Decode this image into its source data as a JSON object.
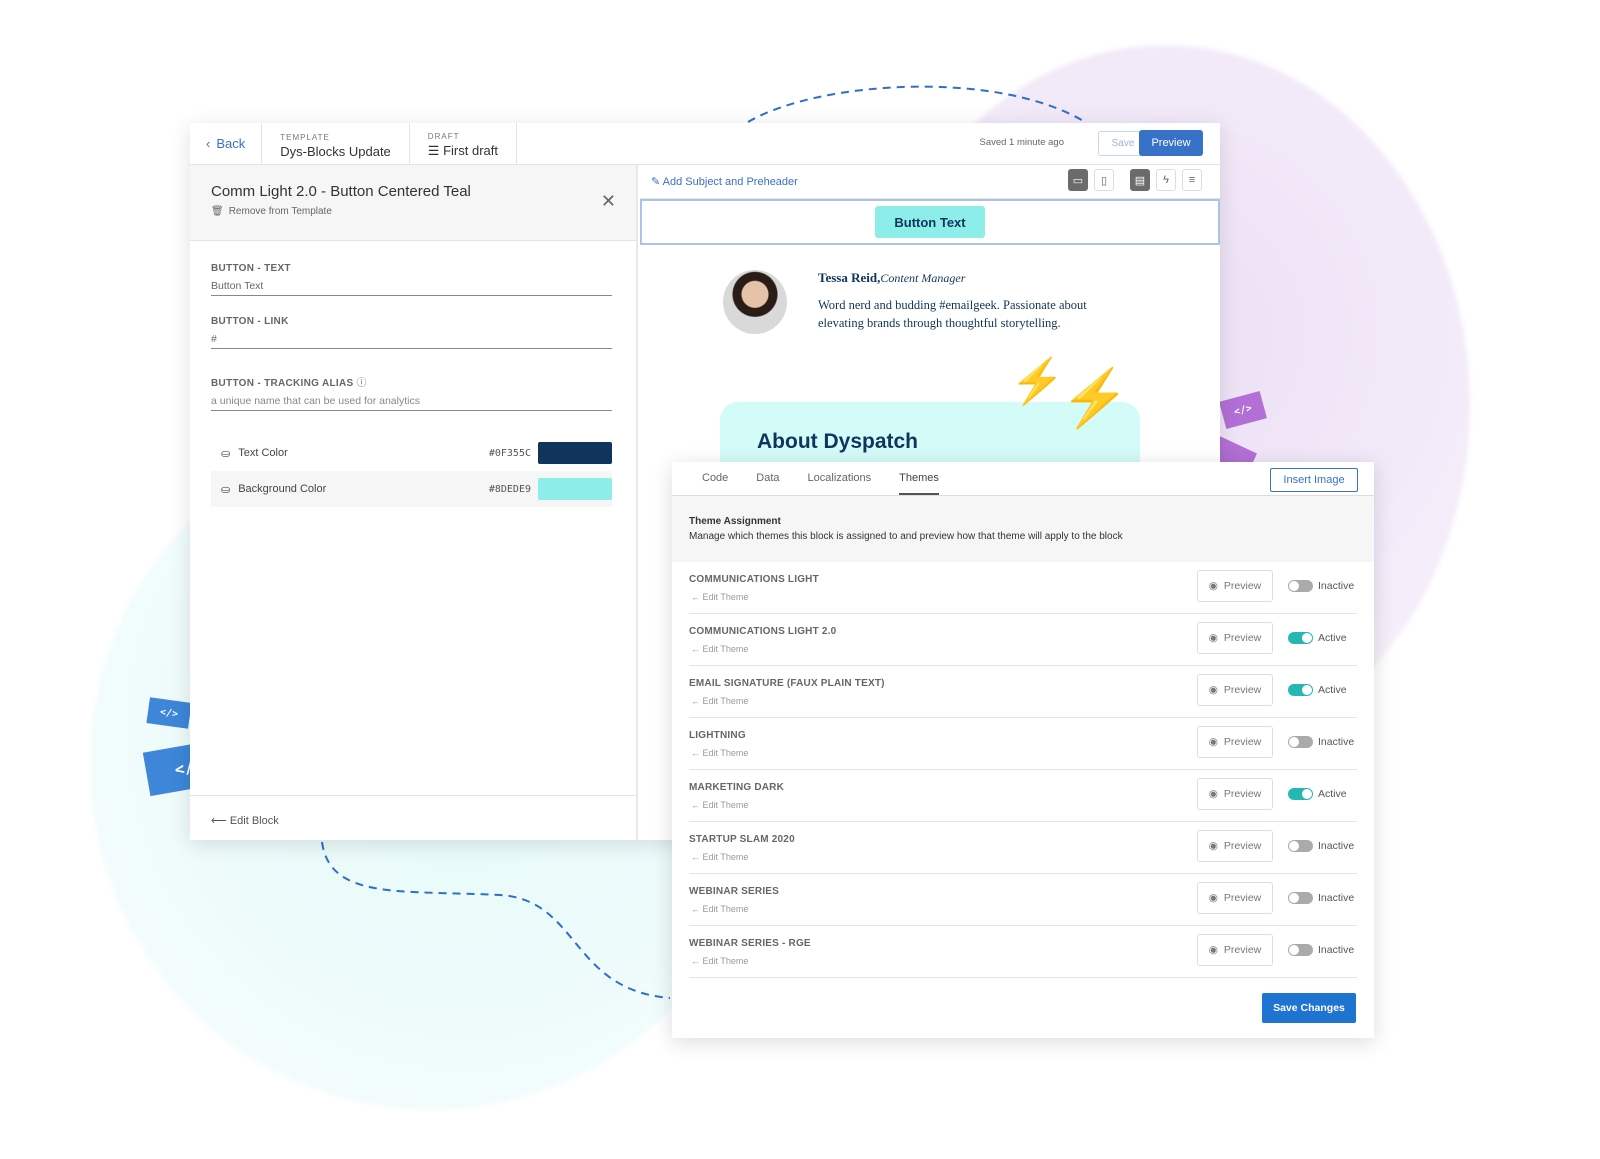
{
  "topbar": {
    "back": "Back",
    "template_label": "TEMPLATE",
    "template_name": "Dys-Blocks Update",
    "draft_label": "DRAFT",
    "draft_name": "First draft",
    "saved": "Saved 1 minute ago",
    "save": "Save",
    "preview": "Preview"
  },
  "block": {
    "title": "Comm Light 2.0 - Button Centered Teal",
    "remove": "Remove from Template",
    "fields": [
      {
        "label": "BUTTON - TEXT",
        "value": "Button Text"
      },
      {
        "label": "BUTTON - LINK",
        "value": "#"
      },
      {
        "label": "BUTTON - TRACKING ALIAS",
        "placeholder": "a unique name that can be used for analytics"
      }
    ],
    "colors": [
      {
        "label": "Text Color",
        "hex": "#0F355C"
      },
      {
        "label": "Background Color",
        "hex": "#8DEDE9"
      }
    ],
    "edit_block": "Edit Block"
  },
  "preview": {
    "subject_link": "Add Subject and Preheader",
    "button_text": "Button Text",
    "sig_name": "Tessa Reid,",
    "sig_role": "Content Manager",
    "sig_bio": "Word nerd and budding #emailgeek. Passionate about elevating brands through thoughtful storytelling.",
    "about": "About Dyspatch"
  },
  "themes_panel": {
    "tabs": [
      "Code",
      "Data",
      "Localizations",
      "Themes"
    ],
    "active_tab": "Themes",
    "insert_image": "Insert Image",
    "assign_title": "Theme Assignment",
    "assign_desc": "Manage which themes this block is assigned to and preview how that theme will apply to the block",
    "edit_theme": "Edit Theme",
    "preview_label": "Preview",
    "themes": [
      {
        "name": "COMMUNICATIONS LIGHT",
        "status": "Inactive",
        "active": false
      },
      {
        "name": "COMMUNICATIONS LIGHT 2.0",
        "status": "Active",
        "active": true
      },
      {
        "name": "EMAIL SIGNATURE (FAUX PLAIN TEXT)",
        "status": "Active",
        "active": true
      },
      {
        "name": "LIGHTNING",
        "status": "Inactive",
        "active": false
      },
      {
        "name": "MARKETING DARK",
        "status": "Active",
        "active": true
      },
      {
        "name": "STARTUP SLAM 2020",
        "status": "Inactive",
        "active": false
      },
      {
        "name": "WEBINAR SERIES",
        "status": "Inactive",
        "active": false
      },
      {
        "name": "WEBINAR SERIES - RGE",
        "status": "Inactive",
        "active": false
      }
    ],
    "save_changes": "Save Changes"
  },
  "decor": {
    "code_tag": "</>"
  },
  "colors": {
    "accent": "#3772c8",
    "toggle_on": "#25b8b3",
    "teal": "#8DEDE9",
    "navy": "#0F355C"
  }
}
